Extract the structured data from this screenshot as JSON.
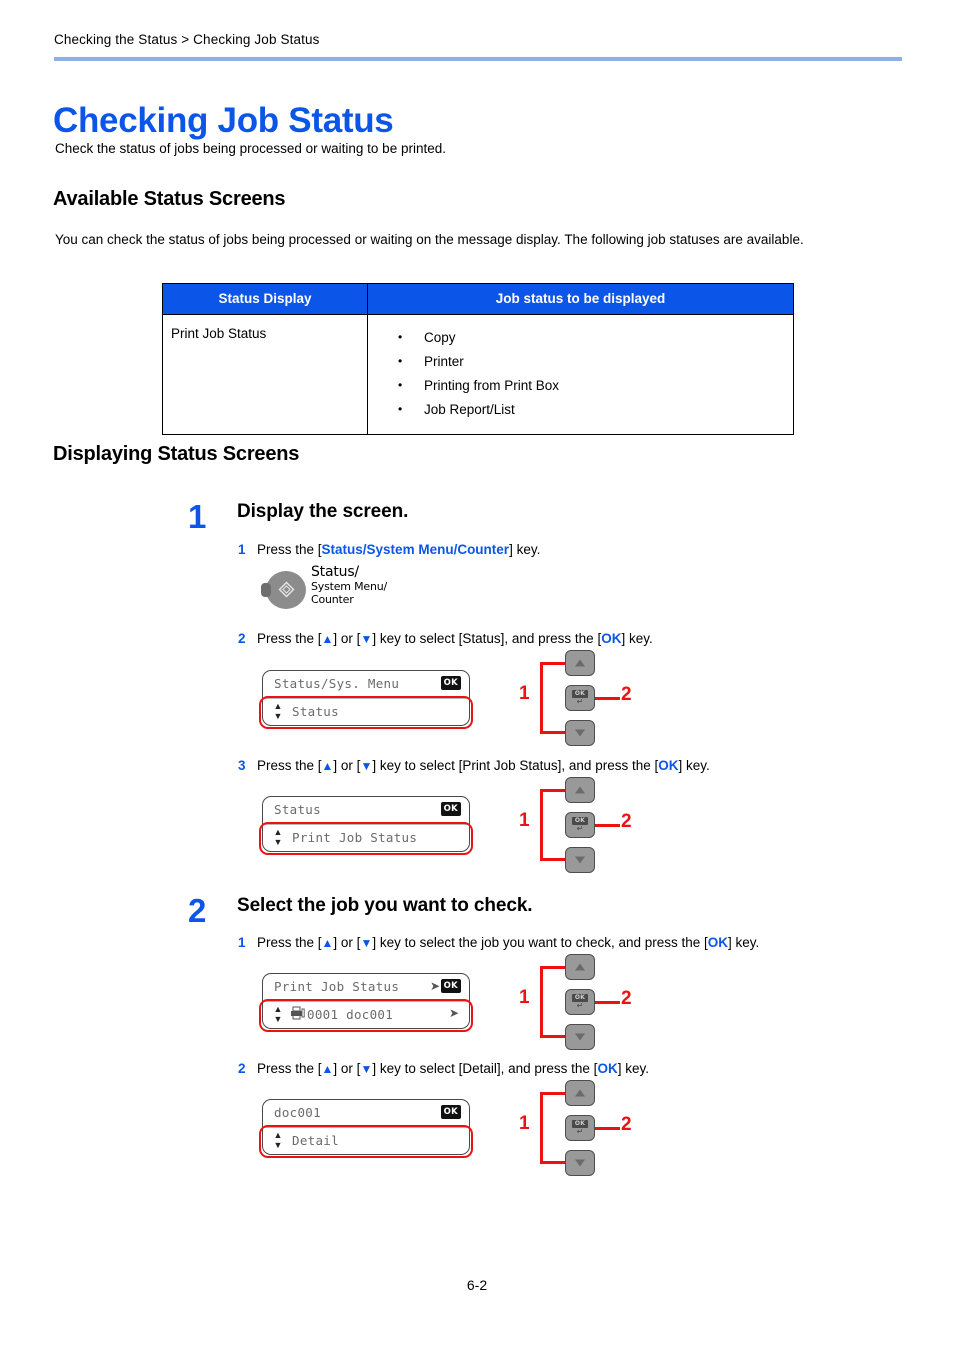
{
  "breadcrumb": "Checking the Status > Checking Job Status",
  "title": "Checking Job Status",
  "intro": "Check the status of jobs being processed or waiting to be printed.",
  "sections": {
    "available": {
      "heading": "Available Status Screens",
      "paragraph": "You can check the status of jobs being processed or waiting on the message display. The following job statuses are available.",
      "table": {
        "headers": [
          "Status Display",
          "Job status to be displayed"
        ],
        "row_label": "Print Job Status",
        "bullets": [
          "Copy",
          "Printer",
          "Printing from Print Box",
          "Job Report/List"
        ]
      }
    },
    "displaying": {
      "heading": "Displaying Status Screens"
    }
  },
  "steps": [
    {
      "number": "1",
      "title": "Display the screen.",
      "substeps": [
        {
          "number": "1",
          "pre": "Press the [",
          "key": "Status/System Menu/Counter",
          "post": "] key."
        },
        {
          "number": "2",
          "text_parts": [
            "Press the [",
            "] or [",
            "] key to select [Status], and press the [",
            "] key."
          ]
        },
        {
          "number": "3",
          "text_parts": [
            "Press the [",
            "] or [",
            "] key to select [Print Job Status], and press the [",
            "] key."
          ]
        }
      ]
    },
    {
      "number": "2",
      "title": "Select the job you want to check.",
      "substeps": [
        {
          "number": "1",
          "text_parts": [
            "Press the [",
            "] or [",
            "] key to select the job you want to check, and press the [",
            "] key."
          ]
        },
        {
          "number": "2",
          "text_parts": [
            "Press the [",
            "] or [",
            "] key to select [Detail], and press the [",
            "] key."
          ]
        }
      ]
    }
  ],
  "status_key": {
    "line1": "Status/",
    "line2": "System Menu/",
    "line3": "Counter"
  },
  "lcd_screens": [
    {
      "title": "Status/Sys. Menu",
      "badge": "OK",
      "selected": "Status",
      "has_arrow_title": false,
      "has_arrow_row": false
    },
    {
      "title": "Status",
      "badge": "OK",
      "selected": "Print Job Status",
      "has_arrow_title": false,
      "has_arrow_row": false
    },
    {
      "title": "Print Job Status",
      "badge": "OK",
      "selected": "0001 doc001",
      "has_arrow_title": true,
      "has_arrow_row": true
    },
    {
      "title": "doc001",
      "badge": "OK",
      "selected": "Detail",
      "has_arrow_title": false,
      "has_arrow_row": false
    }
  ],
  "key_cluster": {
    "label_1": "1",
    "label_2": "2",
    "ok_text": "OK"
  },
  "ok_key_label": "OK",
  "footer": "6-2",
  "colors": {
    "accent_blue": "#0b56e8",
    "rule_blue": "#8cb0e8",
    "highlight_red": "#ee1111",
    "key_gray": "#999999"
  }
}
